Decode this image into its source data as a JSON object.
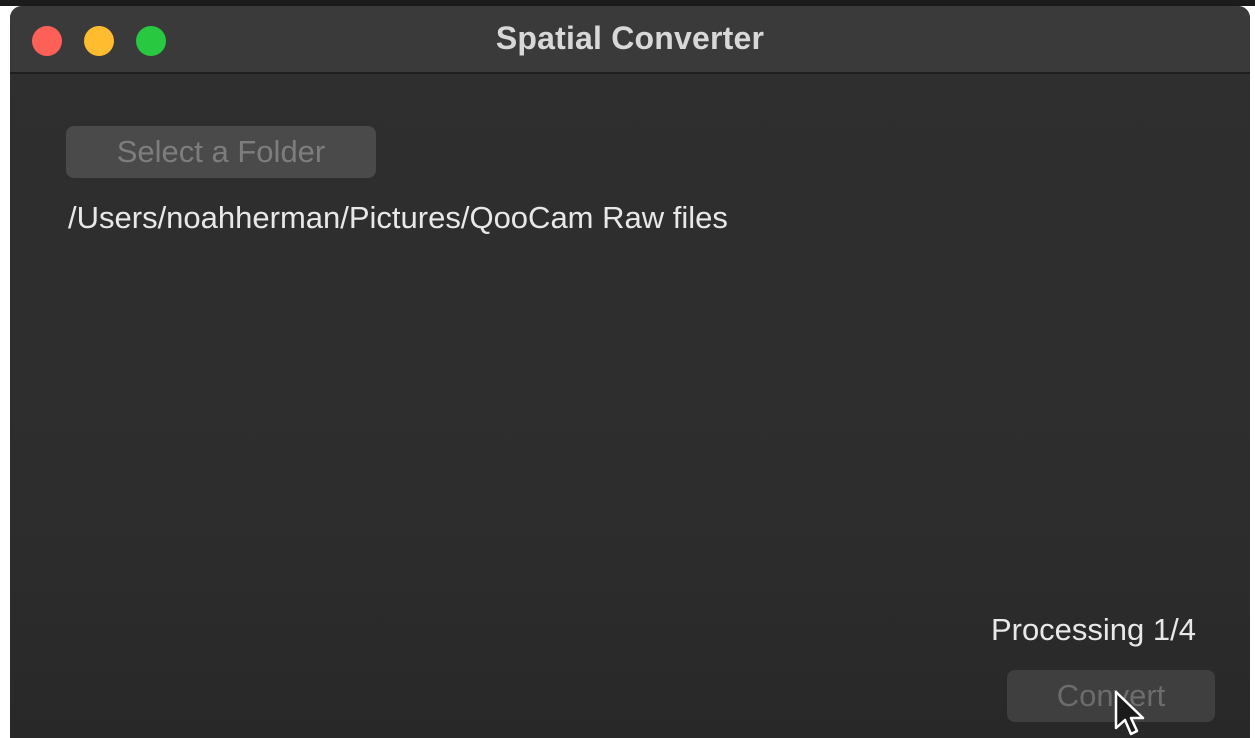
{
  "window": {
    "title": "Spatial Converter"
  },
  "controls": {
    "select_folder_label": "Select a Folder",
    "selected_path": "/Users/noahherman/Pictures/QooCam Raw files",
    "status_text": "Processing 1/4",
    "convert_label": "Convert"
  },
  "colors": {
    "close": "#fe5f57",
    "minimize": "#febc2e",
    "zoom": "#28c840",
    "window_bg": "#2d2d2d",
    "text": "#e8e8e8"
  },
  "icons": {
    "cursor": "mouse-pointer-icon"
  }
}
